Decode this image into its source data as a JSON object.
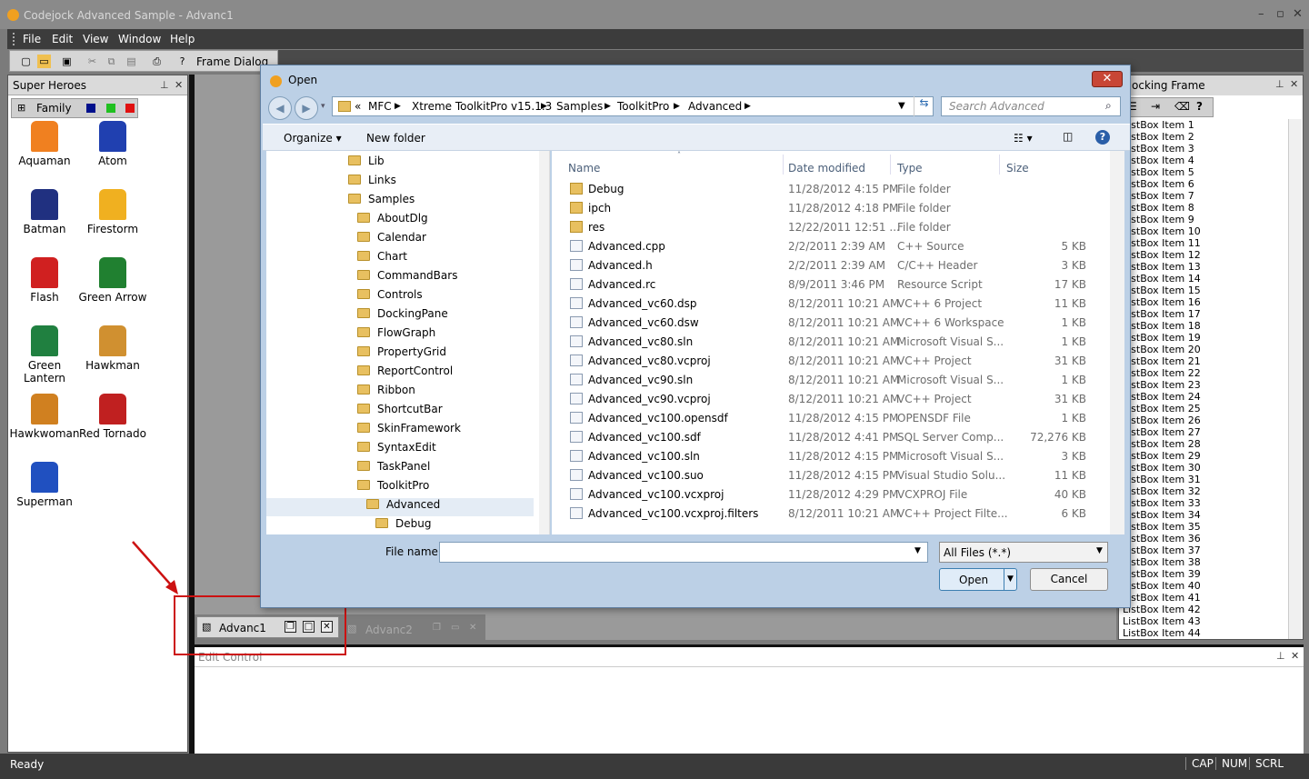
{
  "app": {
    "title": "Codejock Advanced Sample - Advanc1"
  },
  "menu": [
    "File",
    "Edit",
    "View",
    "Window",
    "Help"
  ],
  "toolbar": {
    "frame_label": "Frame",
    "dialog_label": "Dialog"
  },
  "left_pane": {
    "title": "Super Heroes",
    "toolbar_label": "Family",
    "swatches": [
      "#00108c",
      "#20c020",
      "#e01010"
    ],
    "heroes": [
      {
        "name": "Aquaman",
        "color": "#f08020"
      },
      {
        "name": "Atom",
        "color": "#2040b0"
      },
      {
        "name": "Batman",
        "color": "#203080"
      },
      {
        "name": "Firestorm",
        "color": "#f0b020"
      },
      {
        "name": "Flash",
        "color": "#d02020"
      },
      {
        "name": "Green Arrow",
        "color": "#208030"
      },
      {
        "name": "Green Lantern",
        "color": "#208040"
      },
      {
        "name": "Hawkman",
        "color": "#d09030"
      },
      {
        "name": "Hawkwoman",
        "color": "#d08020"
      },
      {
        "name": "Red Tornado",
        "color": "#c02020"
      },
      {
        "name": "Superman",
        "color": "#2050c0"
      }
    ]
  },
  "mdi_tabs": [
    {
      "label": "Advanc1"
    },
    {
      "label": "Advanc2"
    }
  ],
  "edit_pane": {
    "title": "Edit Control"
  },
  "right_pane": {
    "title": "ocking Frame",
    "items": [
      "ListBox Item 1",
      "ListBox Item 2",
      "ListBox Item 3",
      "ListBox Item 4",
      "ListBox Item 5",
      "ListBox Item 6",
      "ListBox Item 7",
      "ListBox Item 8",
      "ListBox Item 9",
      "ListBox Item 10",
      "ListBox Item 11",
      "ListBox Item 12",
      "ListBox Item 13",
      "ListBox Item 14",
      "ListBox Item 15",
      "ListBox Item 16",
      "ListBox Item 17",
      "ListBox Item 18",
      "ListBox Item 19",
      "ListBox Item 20",
      "ListBox Item 21",
      "ListBox Item 22",
      "ListBox Item 23",
      "ListBox Item 24",
      "ListBox Item 25",
      "ListBox Item 26",
      "ListBox Item 27",
      "ListBox Item 28",
      "ListBox Item 29",
      "ListBox Item 30",
      "ListBox Item 31",
      "ListBox Item 32",
      "ListBox Item 33",
      "ListBox Item 34",
      "ListBox Item 35",
      "ListBox Item 36",
      "ListBox Item 37",
      "ListBox Item 38",
      "ListBox Item 39",
      "ListBox Item 40",
      "ListBox Item 41",
      "ListBox Item 42",
      "ListBox Item 43",
      "ListBox Item 44"
    ]
  },
  "status": {
    "ready": "Ready",
    "indicators": [
      "CAP",
      "NUM",
      "SCRL"
    ]
  },
  "dialog": {
    "title": "Open",
    "breadcrumb": [
      "«",
      "MFC",
      "Xtreme ToolkitPro v15.1.3",
      "Samples",
      "ToolkitPro",
      "Advanced"
    ],
    "search_placeholder": "Search Advanced",
    "organize_label": "Organize",
    "new_folder_label": "New folder",
    "tree": [
      {
        "label": "Lib",
        "level": 0
      },
      {
        "label": "Links",
        "level": 0
      },
      {
        "label": "Samples",
        "level": 0
      },
      {
        "label": "AboutDlg",
        "level": 1
      },
      {
        "label": "Calendar",
        "level": 1
      },
      {
        "label": "Chart",
        "level": 1
      },
      {
        "label": "CommandBars",
        "level": 1
      },
      {
        "label": "Controls",
        "level": 1
      },
      {
        "label": "DockingPane",
        "level": 1
      },
      {
        "label": "FlowGraph",
        "level": 1
      },
      {
        "label": "PropertyGrid",
        "level": 1
      },
      {
        "label": "ReportControl",
        "level": 1
      },
      {
        "label": "Ribbon",
        "level": 1
      },
      {
        "label": "ShortcutBar",
        "level": 1
      },
      {
        "label": "SkinFramework",
        "level": 1
      },
      {
        "label": "SyntaxEdit",
        "level": 1
      },
      {
        "label": "TaskPanel",
        "level": 1
      },
      {
        "label": "ToolkitPro",
        "level": 1
      },
      {
        "label": "Advanced",
        "level": 2,
        "selected": true
      },
      {
        "label": "Debug",
        "level": 3
      }
    ],
    "columns": [
      "Name",
      "Date modified",
      "Type",
      "Size"
    ],
    "files": [
      {
        "name": "Debug",
        "date": "11/28/2012 4:15 PM",
        "type": "File folder",
        "size": "",
        "folder": true
      },
      {
        "name": "ipch",
        "date": "11/28/2012 4:18 PM",
        "type": "File folder",
        "size": "",
        "folder": true
      },
      {
        "name": "res",
        "date": "12/22/2011 12:51 ...",
        "type": "File folder",
        "size": "",
        "folder": true
      },
      {
        "name": "Advanced.cpp",
        "date": "2/2/2011 2:39 AM",
        "type": "C++ Source",
        "size": "5 KB"
      },
      {
        "name": "Advanced.h",
        "date": "2/2/2011 2:39 AM",
        "type": "C/C++ Header",
        "size": "3 KB"
      },
      {
        "name": "Advanced.rc",
        "date": "8/9/2011 3:46 PM",
        "type": "Resource Script",
        "size": "17 KB"
      },
      {
        "name": "Advanced_vc60.dsp",
        "date": "8/12/2011 10:21 AM",
        "type": "VC++ 6 Project",
        "size": "11 KB"
      },
      {
        "name": "Advanced_vc60.dsw",
        "date": "8/12/2011 10:21 AM",
        "type": "VC++ 6 Workspace",
        "size": "1 KB"
      },
      {
        "name": "Advanced_vc80.sln",
        "date": "8/12/2011 10:21 AM",
        "type": "Microsoft Visual S...",
        "size": "1 KB"
      },
      {
        "name": "Advanced_vc80.vcproj",
        "date": "8/12/2011 10:21 AM",
        "type": "VC++ Project",
        "size": "31 KB"
      },
      {
        "name": "Advanced_vc90.sln",
        "date": "8/12/2011 10:21 AM",
        "type": "Microsoft Visual S...",
        "size": "1 KB"
      },
      {
        "name": "Advanced_vc90.vcproj",
        "date": "8/12/2011 10:21 AM",
        "type": "VC++ Project",
        "size": "31 KB"
      },
      {
        "name": "Advanced_vc100.opensdf",
        "date": "11/28/2012 4:15 PM",
        "type": "OPENSDF File",
        "size": "1 KB"
      },
      {
        "name": "Advanced_vc100.sdf",
        "date": "11/28/2012 4:41 PM",
        "type": "SQL Server Comp...",
        "size": "72,276 KB"
      },
      {
        "name": "Advanced_vc100.sln",
        "date": "11/28/2012 4:15 PM",
        "type": "Microsoft Visual S...",
        "size": "3 KB"
      },
      {
        "name": "Advanced_vc100.suo",
        "date": "11/28/2012 4:15 PM",
        "type": "Visual Studio Solu...",
        "size": "11 KB"
      },
      {
        "name": "Advanced_vc100.vcxproj",
        "date": "11/28/2012 4:29 PM",
        "type": "VCXPROJ File",
        "size": "40 KB"
      },
      {
        "name": "Advanced_vc100.vcxproj.filters",
        "date": "8/12/2011 10:21 AM",
        "type": "VC++ Project Filte...",
        "size": "6 KB"
      }
    ],
    "file_name_label": "File name:",
    "file_name_value": "",
    "filter_value": "All Files (*.*)",
    "open_label": "Open",
    "cancel_label": "Cancel"
  }
}
